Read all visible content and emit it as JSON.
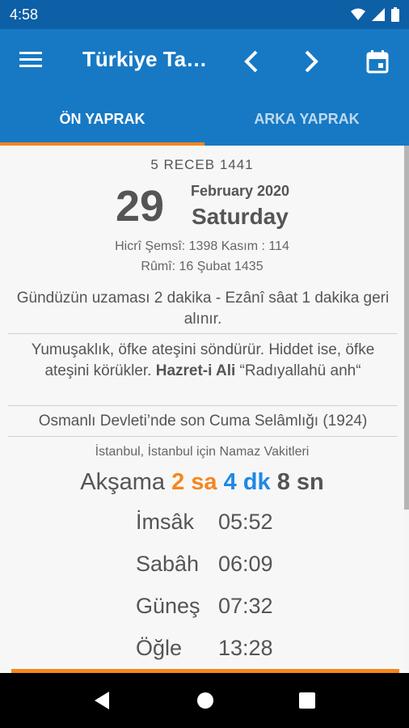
{
  "status": {
    "time": "4:58"
  },
  "appbar": {
    "title": "Türkiye Ta…"
  },
  "tabs": [
    {
      "label": "ÖN YAPRAK",
      "active": true
    },
    {
      "label": "ARKA YAPRAK",
      "active": false
    }
  ],
  "calendar": {
    "hijri": "5  RECEB  1441",
    "day": "29",
    "month_year": "February 2020",
    "weekday": "Saturday",
    "line1": "Hicrî Şemsî: 1398   Kasım : 114",
    "line2": "Rûmî: 16 Şubat 1435"
  },
  "notes": {
    "note1": "Gündüzün uzaması 2 dakika - Ezânî sâat 1 dakika geri alınır.",
    "quote_text": "Yumuşaklık, öfke ateşini söndürür. Hiddet ise, öfke ateşini körükler. ",
    "quote_author": "Hazret-i Ali",
    "quote_suffix": " “Radıyallahü anh“",
    "history": "Osmanlı Devleti’nde son Cuma Selâmlığı (1924)"
  },
  "prayer": {
    "location": "İstanbul, İstanbul için Namaz Vakitleri",
    "countdown_label": "Akşama",
    "hours": "2 sa",
    "minutes": "4 dk",
    "seconds": "8 sn",
    "times": [
      {
        "name": "İmsâk",
        "time": "05:52"
      },
      {
        "name": "Sabâh",
        "time": "06:09"
      },
      {
        "name": "Güneş",
        "time": "07:32"
      },
      {
        "name": "Öğle",
        "time": "13:28"
      }
    ]
  },
  "colors": {
    "primary": "#1779c4",
    "statusbar": "#0d5fa6",
    "accent": "#f5871f",
    "blue": "#1e88e5"
  }
}
